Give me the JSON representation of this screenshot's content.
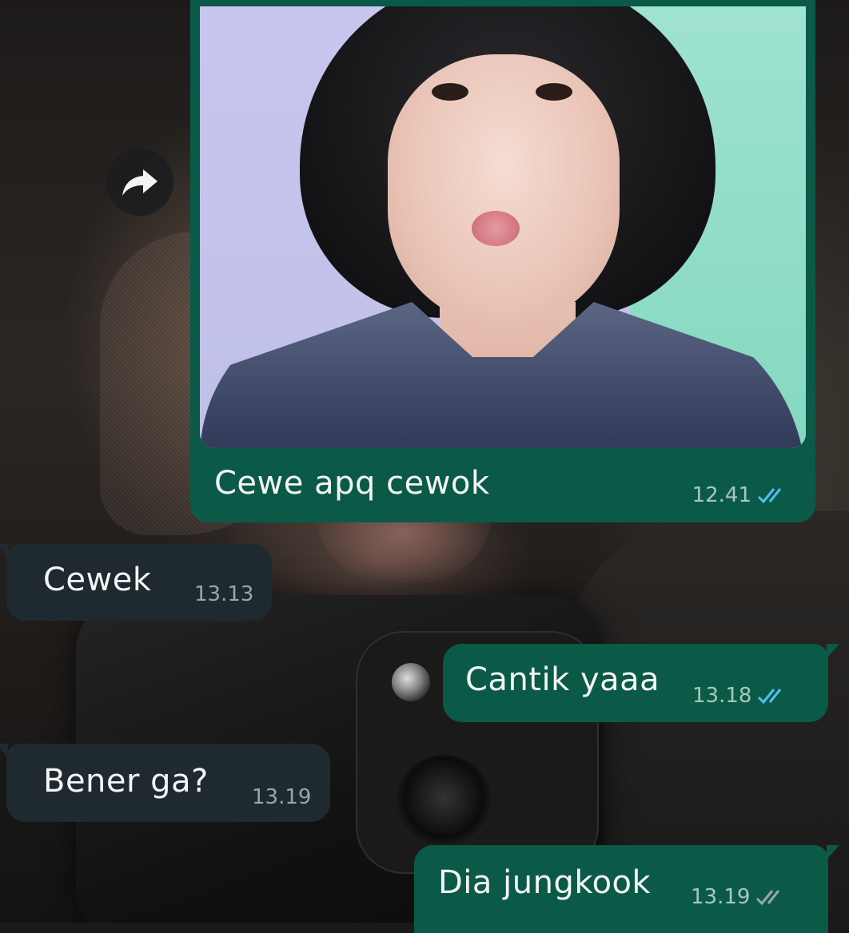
{
  "messages": [
    {
      "type": "image",
      "direction": "outgoing",
      "caption": "Cewe apq cewok",
      "time": "12.41",
      "status": "read"
    },
    {
      "type": "text",
      "direction": "incoming",
      "text": "Cewek",
      "time": "13.13"
    },
    {
      "type": "text",
      "direction": "outgoing",
      "text": "Cantik yaaa",
      "time": "13.18",
      "status": "read"
    },
    {
      "type": "text",
      "direction": "incoming",
      "text": "Bener ga?",
      "time": "13.19"
    },
    {
      "type": "text",
      "direction": "outgoing",
      "text": "Dia jungkook",
      "time": "13.19",
      "status": "delivered"
    }
  ],
  "colors": {
    "outgoing_bubble": "#0b5a48",
    "incoming_bubble": "#1e2a30",
    "read_tick": "#53bdeb",
    "delivered_tick": "#9aa6ab"
  },
  "icons": {
    "forward": "forward-arrow-icon",
    "read_receipt": "double-check-icon"
  }
}
